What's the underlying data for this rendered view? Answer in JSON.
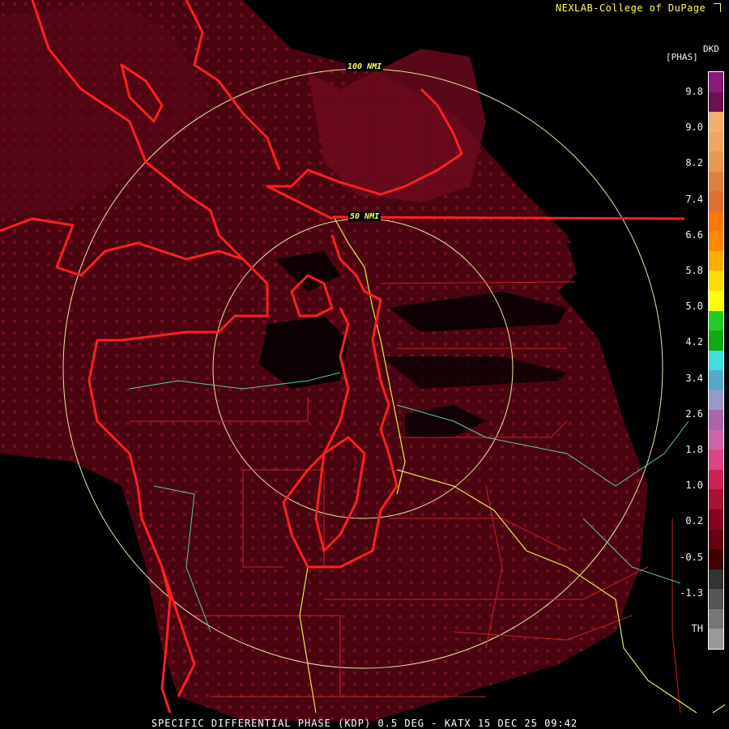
{
  "header": {
    "credit": "NEXLAB-College of DuPage",
    "credit_icon": "arrow-icon"
  },
  "footer": {
    "caption": "SPECIFIC DIFFERENTIAL PHASE (KDP) 0.5 DEG - KATX 15 DEC 25 09:42"
  },
  "rings": [
    {
      "label": "100 NMI"
    },
    {
      "label": "50 NMI"
    }
  ],
  "colorbar": {
    "unit_top": "DKD",
    "unit_sub": "[PHAS]",
    "labels": [
      "9.8",
      "9.0",
      "8.2",
      "7.4",
      "6.6",
      "5.8",
      "5.0",
      "4.2",
      "3.4",
      "2.6",
      "1.8",
      "1.0",
      "0.2",
      "-0.5",
      "-1.3",
      "TH"
    ],
    "colors": [
      "#8a1a7a",
      "#6b1050",
      "#f0b070",
      "#f0a860",
      "#e89850",
      "#e08040",
      "#e07030",
      "#ff7700",
      "#ff8800",
      "#ffaa00",
      "#ffdd00",
      "#ffff00",
      "#22cc22",
      "#11aa11",
      "#44dddd",
      "#55aacc",
      "#9999cc",
      "#aa66aa",
      "#cc66aa",
      "#dd4488",
      "#cc2255",
      "#aa1133",
      "#880022",
      "#660011",
      "#440000",
      "#333333",
      "#555555",
      "#777777",
      "#999999"
    ]
  }
}
